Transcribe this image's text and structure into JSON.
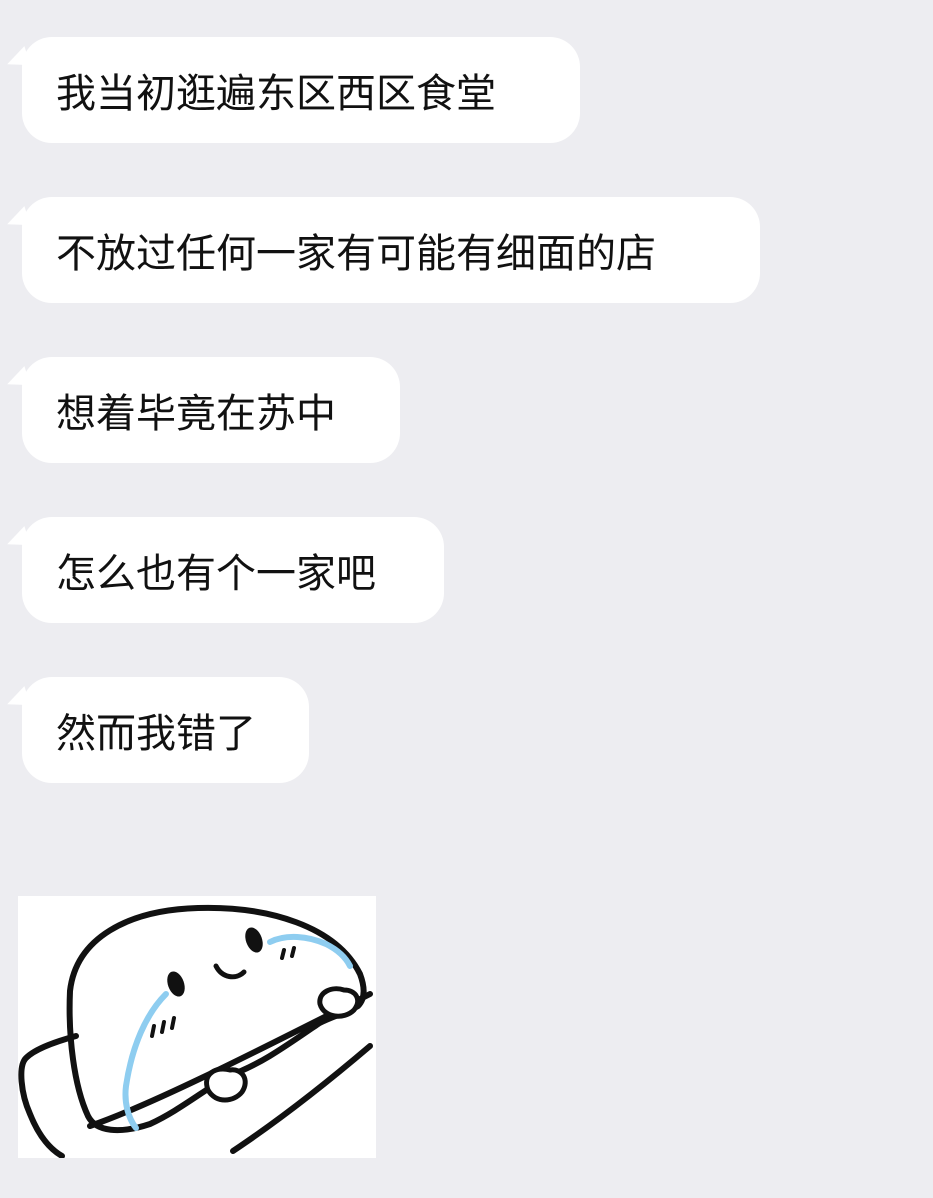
{
  "messages": [
    {
      "text": "我当初逛遍东区西区食堂"
    },
    {
      "text": "不放过任何一家有可能有细面的店"
    },
    {
      "text": "想着毕竟在苏中"
    },
    {
      "text": "怎么也有个一家吧"
    },
    {
      "text": "然而我错了"
    }
  ],
  "sticker": {
    "icon": "crying-blob-in-bed-sticker",
    "colors": {
      "line": "#111111",
      "tears": "#8ecdf0",
      "fill": "#ffffff"
    }
  },
  "theme": {
    "background": "#ededf1",
    "bubble": "#ffffff",
    "text": "#111111"
  }
}
